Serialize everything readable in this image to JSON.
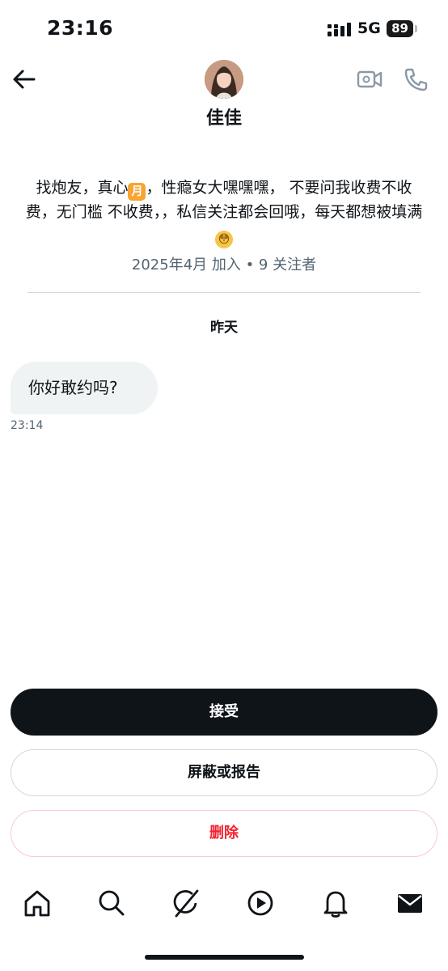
{
  "status_bar": {
    "time": "23:16",
    "network": "5G",
    "battery": "89"
  },
  "header": {
    "name": "佳佳",
    "back_icon": "arrow-left-icon",
    "video_icon": "video-icon",
    "phone_icon": "phone-icon"
  },
  "profile": {
    "bio_part1": "找炮友，真心",
    "bio_emoji1": "月",
    "bio_part2": "，性瘾女大嘿嘿嘿， 不要问我收费不收费，无门槛 不收费，，私信关注都会回哦，每天都想被填满",
    "bio_emoji2": "😳",
    "meta": "2025年4月 加入 • 9 关注者"
  },
  "conversation": {
    "date_separator": "昨天",
    "messages": [
      {
        "text": "你好敢约吗?",
        "time": "23:14"
      }
    ]
  },
  "actions": {
    "accept": "接受",
    "block_or_report": "屏蔽或报告",
    "delete": "删除"
  },
  "nav": {
    "items": [
      "home-icon",
      "search-icon",
      "grok-icon",
      "video-play-icon",
      "notifications-icon",
      "messages-icon"
    ]
  },
  "colors": {
    "primary_text": "#0f1419",
    "secondary_text": "#536471",
    "danger": "#f4212e",
    "bubble_bg": "#eff3f4"
  }
}
